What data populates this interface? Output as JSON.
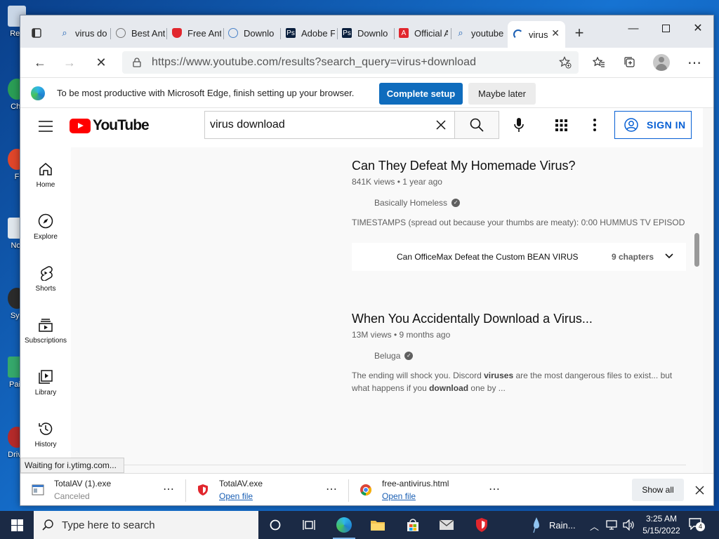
{
  "desktop": {
    "icons": [
      {
        "label": "Rec"
      },
      {
        "label": "Chr"
      },
      {
        "label": "F"
      },
      {
        "label": "Not"
      },
      {
        "label": "Sys"
      },
      {
        "label": "Pain"
      },
      {
        "label": "Drive"
      }
    ]
  },
  "browser": {
    "tabs": [
      {
        "label": "virus do",
        "icon": "search-icon"
      },
      {
        "label": "Best Ant",
        "icon": "chat-icon"
      },
      {
        "label": "Free Ant",
        "icon": "shield-icon"
      },
      {
        "label": "Downlo",
        "icon": "globe-icon"
      },
      {
        "label": "Adobe F",
        "icon": "adobe-photoshop-icon"
      },
      {
        "label": "Downlo",
        "icon": "adobe-photoshop-icon"
      },
      {
        "label": "Official A",
        "icon": "adobe-icon"
      },
      {
        "label": "youtube",
        "icon": "search-icon"
      },
      {
        "label": "virus",
        "icon": "loading-icon",
        "active": true
      }
    ],
    "url": "https://www.youtube.com/results?search_query=virus+download",
    "infobar": {
      "text": "To be most productive with Microsoft Edge, finish setting up your browser.",
      "primary": "Complete setup",
      "secondary": "Maybe later"
    },
    "status": "Waiting for i.ytimg.com..."
  },
  "youtube": {
    "brand": "YouTube",
    "search_query": "virus download",
    "sign_in": "SIGN IN",
    "guide": [
      {
        "label": "Home",
        "icon": "home-icon"
      },
      {
        "label": "Explore",
        "icon": "compass-icon"
      },
      {
        "label": "Shorts",
        "icon": "shorts-icon"
      },
      {
        "label": "Subscriptions",
        "icon": "subscriptions-icon"
      },
      {
        "label": "Library",
        "icon": "library-icon"
      },
      {
        "label": "History",
        "icon": "history-icon"
      }
    ],
    "results": [
      {
        "title": "Can They Defeat My Homemade Virus?",
        "meta": "841K views • 1 year ago",
        "channel": "Basically Homeless",
        "description": "TIMESTAMPS (spread out because your thumbs are meaty): 0:00 HUMMUS TV EPISOD...",
        "chapter_title": "Can OfficeMax Defeat the Custom BEAN VIRUS",
        "chapter_count": "9 chapters"
      },
      {
        "title": "When You Accidentally Download a Virus...",
        "meta": "13M views • 9 months ago",
        "channel": "Beluga",
        "description_parts": [
          "The ending will shock you. Discord ",
          "viruses",
          " are the most dangerous files to exist... but what happens if you ",
          "download",
          " one by ..."
        ]
      }
    ]
  },
  "downloads": [
    {
      "name": "TotalAV (1).exe",
      "sub": "Canceled",
      "icon": "installer-icon"
    },
    {
      "name": "TotalAV.exe",
      "sub": "Open file",
      "icon": "shield-icon"
    },
    {
      "name": "free-antivirus.html",
      "sub": "Open file",
      "icon": "chrome-icon"
    }
  ],
  "downloads_show_all": "Show all",
  "taskbar": {
    "search_placeholder": "Type here to search",
    "weather": "Rain...",
    "time": "3:25 AM",
    "date": "5/15/2022",
    "notifications": "4"
  }
}
